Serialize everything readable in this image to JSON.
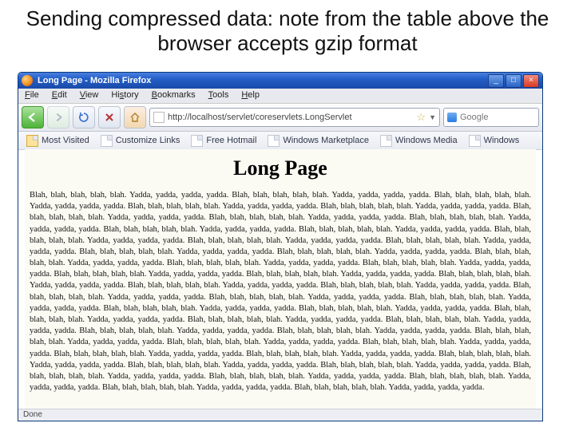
{
  "slide": {
    "title": "Sending compressed data: note from the table above the browser accepts gzip format"
  },
  "window_title": "Long Page - Mozilla Firefox",
  "menu": [
    "File",
    "Edit",
    "View",
    "History",
    "Bookmarks",
    "Tools",
    "Help"
  ],
  "address": {
    "url": "http://localhost/servlet/coreservlets.LongServlet",
    "star": "☆",
    "dd": "▼"
  },
  "search": {
    "placeholder": "Google"
  },
  "bookmarks": {
    "mostVisited": "Most Visited",
    "items": [
      "Customize Links",
      "Free Hotmail",
      "Windows Marketplace",
      "Windows Media",
      "Windows"
    ]
  },
  "page": {
    "heading": "Long Page",
    "body": "Blah, blah, blah, blah, blah. Yadda, yadda, yadda, yadda. Blah, blah, blah, blah, blah. Yadda, yadda, yadda, yadda. Blah, blah, blah, blah, blah. Yadda, yadda, yadda, yadda. Blah, blah, blah, blah, blah. Yadda, yadda, yadda, yadda. Blah, blah, blah, blah, blah. Yadda, yadda, yadda, yadda. Blah, blah, blah, blah, blah. Yadda, yadda, yadda, yadda. Blah, blah, blah, blah, blah. Yadda, yadda, yadda, yadda. Blah, blah, blah, blah, blah. Yadda, yadda, yadda, yadda. Blah, blah, blah, blah, blah. Yadda, yadda, yadda, yadda. Blah, blah, blah, blah, blah. Yadda, yadda, yadda, yadda. Blah, blah, blah, blah, blah. Yadda, yadda, yadda, yadda. Blah, blah, blah, blah, blah. Yadda, yadda, yadda, yadda. Blah, blah, blah, blah, blah. Yadda, yadda, yadda, yadda. Blah, blah, blah, blah, blah. Yadda, yadda, yadda, yadda. Blah, blah, blah, blah, blah. Yadda, yadda, yadda, yadda. Blah, blah, blah, blah, blah. Yadda, yadda, yadda, yadda. Blah, blah, blah, blah, blah. Yadda, yadda, yadda, yadda. Blah, blah, blah, blah, blah. Yadda, yadda, yadda, yadda. Blah, blah, blah, blah, blah. Yadda, yadda, yadda, yadda. Blah, blah, blah, blah, blah. Yadda, yadda, yadda, yadda. Blah, blah, blah, blah, blah. Yadda, yadda, yadda, yadda. Blah, blah, blah, blah, blah. Yadda, yadda, yadda, yadda. Blah, blah, blah, blah, blah. Yadda, yadda, yadda, yadda. Blah, blah, blah, blah, blah. Yadda, yadda, yadda, yadda. Blah, blah, blah, blah, blah. Yadda, yadda, yadda, yadda. Blah, blah, blah, blah, blah. Yadda, yadda, yadda, yadda. Blah, blah, blah, blah, blah. Yadda, yadda, yadda, yadda. Blah, blah, blah, blah, blah. Yadda, yadda, yadda, yadda. Blah, blah, blah, blah, blah. Yadda, yadda, yadda, yadda. Blah, blah, blah, blah, blah. Yadda, yadda, yadda, yadda. Blah, blah, blah, blah, blah. Yadda, yadda, yadda, yadda. Blah, blah, blah, blah, blah. Yadda, yadda, yadda, yadda. Blah, blah, blah, blah, blah. Yadda, yadda, yadda, yadda. Blah, blah, blah, blah, blah. Yadda, yadda, yadda, yadda. Blah, blah, blah, blah, blah. Yadda, yadda, yadda, yadda. Blah, blah, blah, blah, blah. Yadda, yadda, yadda, yadda. Blah, blah, blah, blah, blah. Yadda, yadda, yadda, yadda. Blah, blah, blah, blah, blah. Yadda, yadda, yadda, yadda. Blah, blah, blah, blah, blah. Yadda, yadda, yadda, yadda. Blah, blah, blah, blah, blah. Yadda, yadda, yadda, yadda. Blah, blah, blah, blah, blah. Yadda, yadda, yadda, yadda. Blah, blah, blah, blah, blah. Yadda, yadda, yadda, yadda. Blah, blah, blah, blah, blah. Yadda, yadda, yadda, yadda. Blah, blah, blah, blah, blah. Yadda, yadda, yadda, yadda. Blah, blah, blah, blah, blah. Yadda, yadda, yadda, yadda. Blah, blah, blah, blah, blah. Yadda, yadda, yadda, yadda."
  },
  "status": {
    "done": "Done"
  },
  "winbtns": {
    "min": "_",
    "max": "□",
    "close": "×"
  }
}
